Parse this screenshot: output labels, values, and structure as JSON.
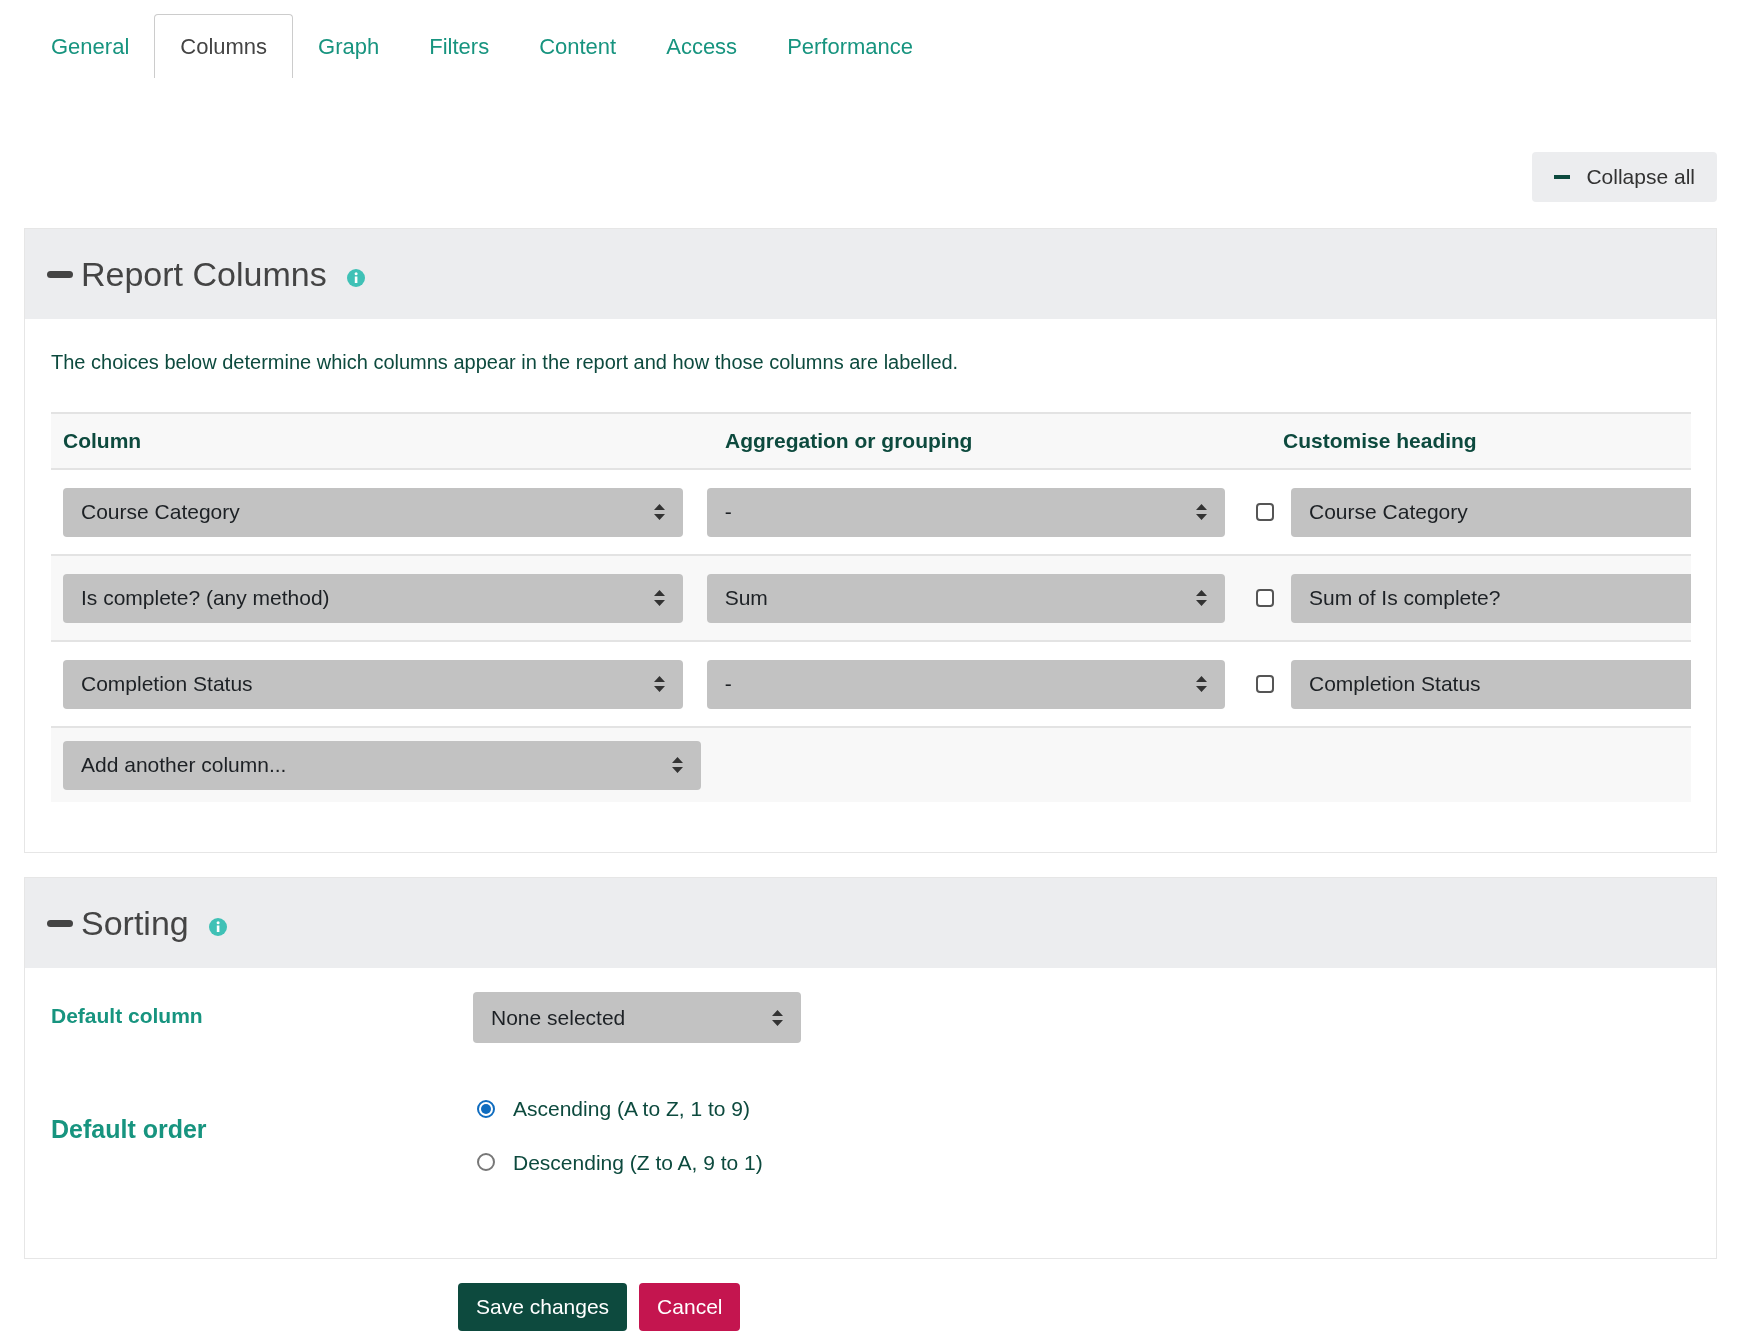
{
  "tabs": [
    {
      "label": "General",
      "selected": false
    },
    {
      "label": "Columns",
      "selected": true
    },
    {
      "label": "Graph",
      "selected": false
    },
    {
      "label": "Filters",
      "selected": false
    },
    {
      "label": "Content",
      "selected": false
    },
    {
      "label": "Access",
      "selected": false
    },
    {
      "label": "Performance",
      "selected": false
    }
  ],
  "collapse_all": {
    "label": "Collapse all"
  },
  "report_columns": {
    "title": "Report Columns",
    "expanded": true,
    "description": "The choices below determine which columns appear in the report and how those columns are labelled.",
    "table": {
      "columns": [
        "Column",
        "Aggregation or grouping",
        "Customise heading"
      ],
      "rows": [
        {
          "column": "Course Category",
          "aggregation": "-",
          "checked": false,
          "heading": "Course Category"
        },
        {
          "column": "Is complete? (any method)",
          "aggregation": "Sum",
          "checked": false,
          "heading": "Sum of Is complete?"
        },
        {
          "column": "Completion Status",
          "aggregation": "-",
          "checked": false,
          "heading": "Completion Status"
        }
      ],
      "add_column": "Add another column..."
    }
  },
  "sorting": {
    "title": "Sorting",
    "expanded": true,
    "default_column": {
      "label": "Default column",
      "value": "None selected"
    },
    "default_order": {
      "label": "Default order",
      "options": [
        {
          "label": "Ascending (A to Z, 1 to 9)",
          "selected": true
        },
        {
          "label": "Descending (Z to A, 9 to 1)",
          "selected": false
        }
      ]
    }
  },
  "buttons": [
    {
      "label": "Save changes",
      "kind": "primary"
    },
    {
      "label": "Cancel",
      "kind": "danger"
    }
  ]
}
